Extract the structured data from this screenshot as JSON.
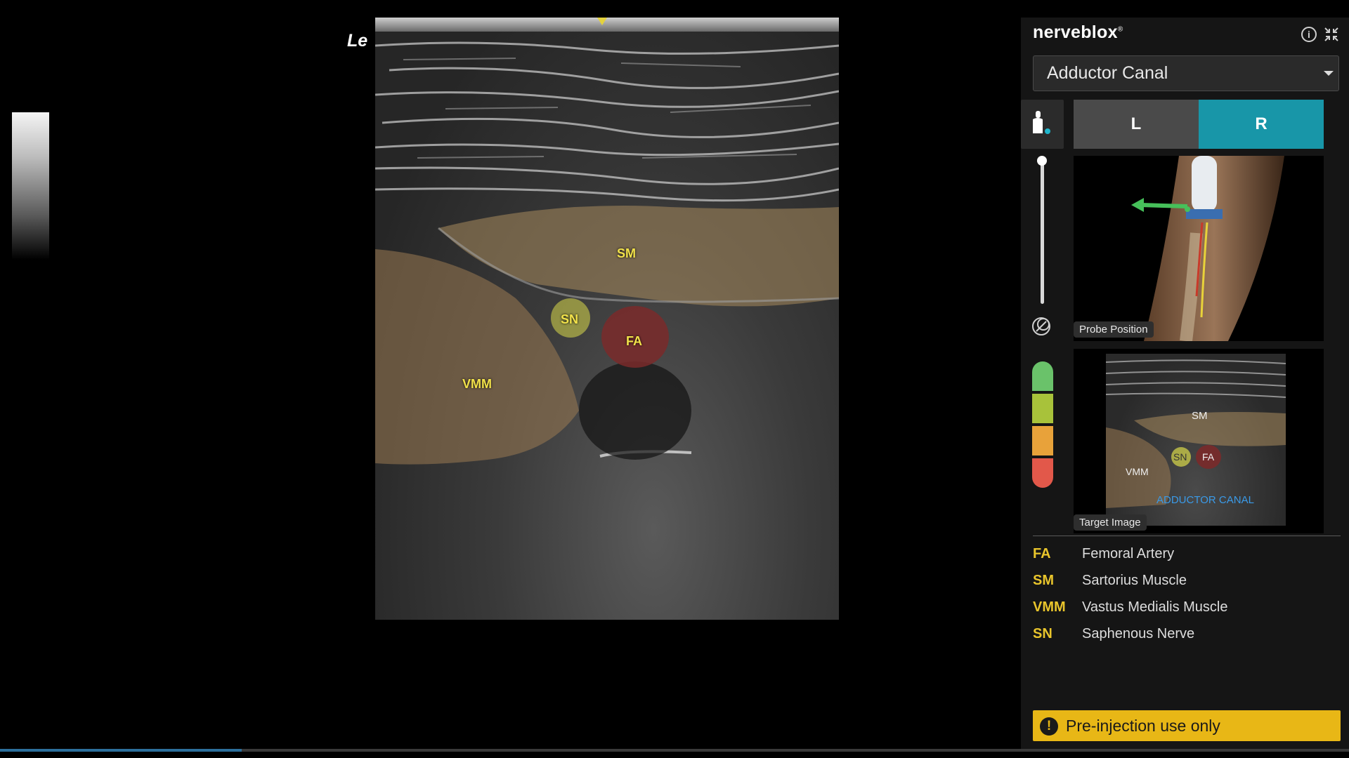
{
  "viewer": {
    "orientation_label": "Le",
    "labels": {
      "sm": "SM",
      "sn": "SN",
      "fa": "FA",
      "vmm": "VMM"
    }
  },
  "panel": {
    "brand": "nerveblox",
    "brand_mark": "®",
    "info_icon": "info-icon",
    "collapse_icon": "collapse-icon",
    "block_select": {
      "value": "Adductor Canal"
    },
    "side_buttons": {
      "left": "L",
      "right": "R",
      "selected": "R"
    },
    "probe_image_label": "Probe Position",
    "target_image_label": "Target Image",
    "target_image": {
      "labels": {
        "sm": "SM",
        "sn": "SN",
        "fa": "FA",
        "vmm": "VMM"
      },
      "caption": "ADDUCTOR CANAL"
    },
    "confidence_colors": [
      "#6ac26a",
      "#a8c23a",
      "#e8a23a",
      "#e2584a"
    ],
    "legend": [
      {
        "abbr": "FA",
        "name": "Femoral Artery"
      },
      {
        "abbr": "SM",
        "name": "Sartorius Muscle"
      },
      {
        "abbr": "VMM",
        "name": "Vastus Medialis Muscle"
      },
      {
        "abbr": "SN",
        "name": "Saphenous Nerve"
      }
    ],
    "warning": "Pre-injection use only",
    "warning_icon": "!"
  },
  "colors": {
    "accent": "#1896a8",
    "warning": "#e8b716",
    "label_yellow": "#e9c52c"
  }
}
